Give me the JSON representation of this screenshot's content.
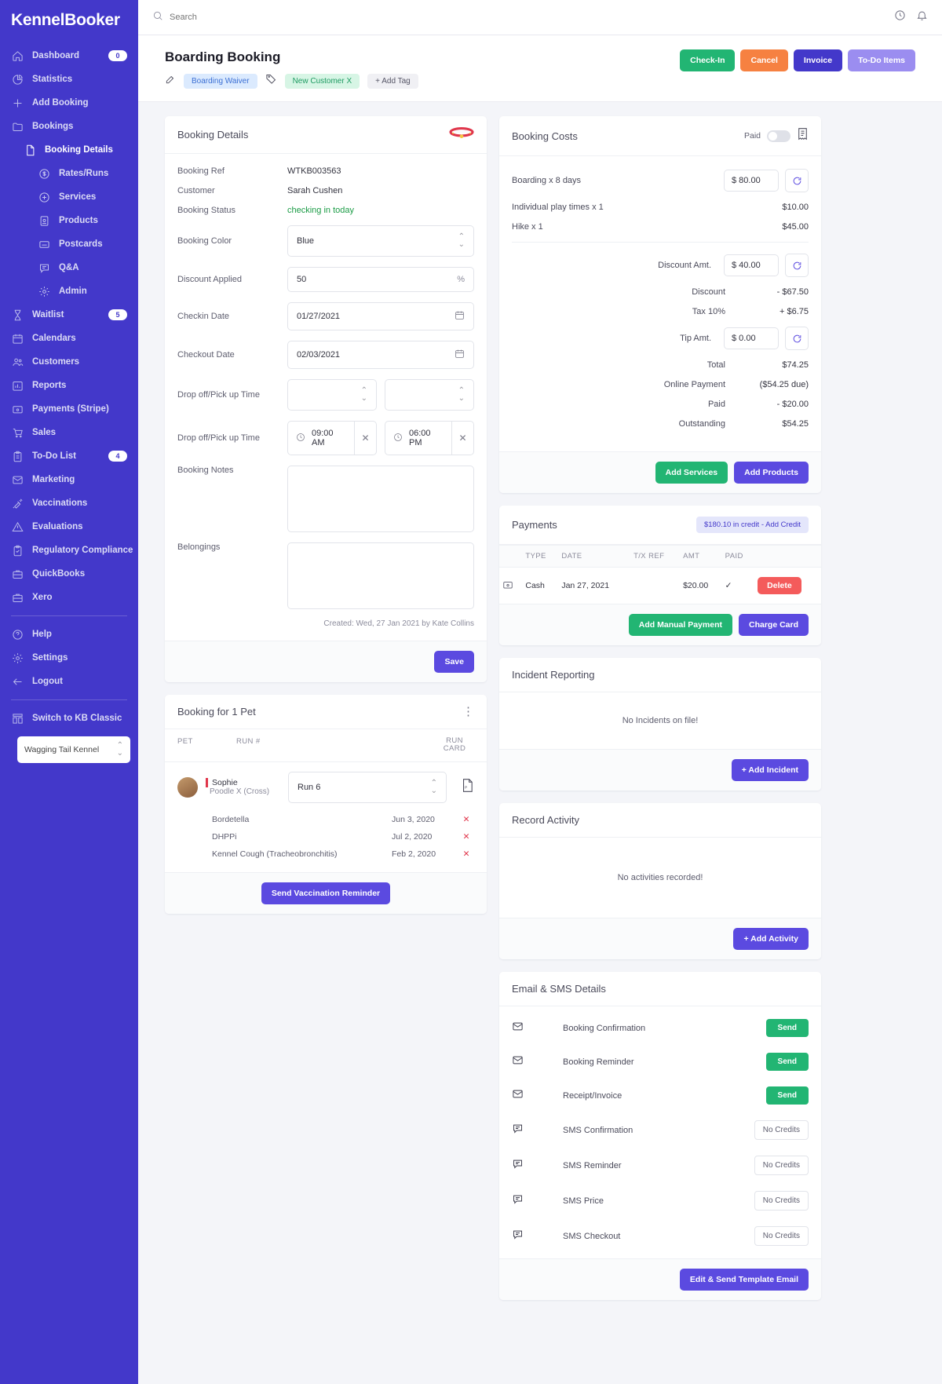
{
  "brand": "KennelBooker",
  "sidebar": {
    "items": [
      {
        "label": "Dashboard",
        "icon": "home-icon",
        "badge": "0",
        "level": 0
      },
      {
        "label": "Statistics",
        "icon": "pie-chart-icon",
        "level": 0
      },
      {
        "label": "Add Booking",
        "icon": "plus-icon",
        "level": 0
      },
      {
        "label": "Bookings",
        "icon": "folder-icon",
        "level": 0
      },
      {
        "label": "Booking Details",
        "icon": "file-icon",
        "level": 1,
        "active": true
      },
      {
        "label": "Rates/Runs",
        "icon": "dollar-icon",
        "level": 2
      },
      {
        "label": "Services",
        "icon": "plus-circle-icon",
        "level": 2
      },
      {
        "label": "Products",
        "icon": "product-icon",
        "level": 2
      },
      {
        "label": "Postcards",
        "icon": "postcard-icon",
        "level": 2
      },
      {
        "label": "Q&A",
        "icon": "chat-icon",
        "level": 2
      },
      {
        "label": "Admin",
        "icon": "gear-icon",
        "level": 2
      },
      {
        "label": "Waitlist",
        "icon": "hourglass-icon",
        "badge": "5",
        "level": 0
      },
      {
        "label": "Calendars",
        "icon": "calendar-icon",
        "level": 0
      },
      {
        "label": "Customers",
        "icon": "users-icon",
        "level": 0
      },
      {
        "label": "Reports",
        "icon": "bar-chart-icon",
        "level": 0
      },
      {
        "label": "Payments (Stripe)",
        "icon": "card-icon",
        "level": 0
      },
      {
        "label": "Sales",
        "icon": "cart-icon",
        "level": 0
      },
      {
        "label": "To-Do List",
        "icon": "clipboard-icon",
        "badge": "4",
        "level": 0
      },
      {
        "label": "Marketing",
        "icon": "mail-icon",
        "level": 0
      },
      {
        "label": "Vaccinations",
        "icon": "syringe-icon",
        "level": 0
      },
      {
        "label": "Evaluations",
        "icon": "warning-icon",
        "level": 0
      },
      {
        "label": "Regulatory Compliance",
        "icon": "clipboard-check-icon",
        "level": 0
      },
      {
        "label": "QuickBooks",
        "icon": "briefcase-icon",
        "level": 0
      },
      {
        "label": "Xero",
        "icon": "briefcase-icon",
        "level": 0
      }
    ],
    "footer_items": [
      {
        "label": "Help",
        "icon": "question-circle-icon"
      },
      {
        "label": "Settings",
        "icon": "gear-icon"
      },
      {
        "label": "Logout",
        "icon": "arrow-left-icon"
      }
    ],
    "switch_label": "Switch to KB Classic",
    "kennel_name": "Wagging Tail Kennel"
  },
  "topbar": {
    "search_placeholder": "Search"
  },
  "page": {
    "title": "Boarding Booking",
    "tags": [
      {
        "label": "Boarding Waiver",
        "style": "waiver"
      },
      {
        "label": "New Customer X",
        "style": "newcust"
      },
      {
        "label": "+ Add Tag",
        "style": "addtag"
      }
    ],
    "actions": [
      {
        "label": "Check-In",
        "color": "green"
      },
      {
        "label": "Cancel",
        "color": "orange"
      },
      {
        "label": "Invoice",
        "color": "blue"
      },
      {
        "label": "To-Do Items",
        "color": "lilac"
      }
    ]
  },
  "booking_details": {
    "title": "Booking Details",
    "booking_ref_label": "Booking Ref",
    "booking_ref": "WTKB003563",
    "customer_label": "Customer",
    "customer": "Sarah Cushen",
    "status_label": "Booking Status",
    "status": "checking in today",
    "color_label": "Booking Color",
    "color_value": "Blue",
    "discount_label": "Discount Applied",
    "discount_value": "50",
    "discount_unit": "%",
    "checkin_label": "Checkin Date",
    "checkin_value": "01/27/2021",
    "checkout_label": "Checkout Date",
    "checkout_value": "02/03/2021",
    "dropoff_label_1": "Drop off/Pick up Time",
    "dropoff_label_2": "Drop off/Pick up Time",
    "time_start": "09:00 AM",
    "time_end": "06:00 PM",
    "notes_label": "Booking Notes",
    "notes_value": "",
    "belongings_label": "Belongings",
    "belongings_value": "",
    "created": "Created: Wed, 27 Jan 2021 by Kate Collins",
    "save_label": "Save"
  },
  "booking_costs": {
    "title": "Booking Costs",
    "paid_label": "Paid",
    "lines": [
      {
        "label": "Boarding  x 8 days",
        "input": "$  80.00",
        "has_input": true,
        "amount": ""
      },
      {
        "label": "Individual play times  x 1",
        "has_input": false,
        "amount": "$10.00"
      },
      {
        "label": "Hike  x 1",
        "has_input": false,
        "amount": "$45.00"
      }
    ],
    "totals": [
      {
        "label": "Discount Amt.",
        "input": "$  40.00",
        "has_input": true,
        "amount": ""
      },
      {
        "label": "Discount",
        "has_input": false,
        "amount": "- $67.50"
      },
      {
        "label": "Tax 10%",
        "has_input": false,
        "amount": "+ $6.75"
      },
      {
        "label": "Tip Amt.",
        "input": "$ 0.00",
        "has_input": true,
        "amount": ""
      },
      {
        "label": "Total",
        "has_input": false,
        "amount": "$74.25"
      },
      {
        "label": "Online Payment",
        "has_input": false,
        "amount": "($54.25 due)"
      },
      {
        "label": "Paid",
        "has_input": false,
        "amount": "- $20.00"
      },
      {
        "label": "Outstanding",
        "has_input": false,
        "amount": "$54.25"
      }
    ],
    "add_services_label": "Add Services",
    "add_products_label": "Add Products"
  },
  "payments": {
    "title": "Payments",
    "credit_chip": "$180.10 in credit - Add Credit",
    "columns": [
      "",
      "TYPE",
      "DATE",
      "T/X REF",
      "AMT",
      "PAID",
      ""
    ],
    "rows": [
      {
        "type": "Cash",
        "date": "Jan 27, 2021",
        "txref": "",
        "amt": "$20.00",
        "paid": "✓",
        "action": "Delete"
      }
    ],
    "add_manual_label": "Add Manual Payment",
    "charge_card_label": "Charge Card"
  },
  "pet_card": {
    "title": "Booking for 1 Pet",
    "columns": {
      "pet": "PET",
      "run": "RUN #",
      "runcard": "RUN CARD"
    },
    "pet_name": "Sophie",
    "pet_breed": "Poodle X (Cross)",
    "run_value": "Run 6",
    "vaccinations": [
      {
        "name": "Bordetella",
        "date": "Jun 3, 2020",
        "status": "✕"
      },
      {
        "name": "DHPPi",
        "date": "Jul 2, 2020",
        "status": "✕"
      },
      {
        "name": "Kennel Cough (Tracheobronchitis)",
        "date": "Feb 2, 2020",
        "status": "✕"
      }
    ],
    "reminder_label": "Send Vaccination Reminder"
  },
  "incident": {
    "title": "Incident Reporting",
    "empty": "No Incidents on file!",
    "add_label": "+ Add Incident"
  },
  "activity": {
    "title": "Record Activity",
    "empty": "No activities recorded!",
    "add_label": "+ Add Activity"
  },
  "email_sms": {
    "title": "Email & SMS Details",
    "rows": [
      {
        "label": "Booking Confirmation",
        "icon": "mail-icon",
        "action": "Send",
        "enabled": true
      },
      {
        "label": "Booking Reminder",
        "icon": "mail-icon",
        "action": "Send",
        "enabled": true
      },
      {
        "label": "Receipt/Invoice",
        "icon": "mail-icon",
        "action": "Send",
        "enabled": true
      },
      {
        "label": "SMS Confirmation",
        "icon": "chat-icon",
        "action": "No Credits",
        "enabled": false
      },
      {
        "label": "SMS Reminder",
        "icon": "chat-icon",
        "action": "No Credits",
        "enabled": false
      },
      {
        "label": "SMS Price",
        "icon": "chat-icon",
        "action": "No Credits",
        "enabled": false
      },
      {
        "label": "SMS Checkout",
        "icon": "chat-icon",
        "action": "No Credits",
        "enabled": false
      }
    ],
    "edit_send_label": "Edit & Send Template Email"
  }
}
